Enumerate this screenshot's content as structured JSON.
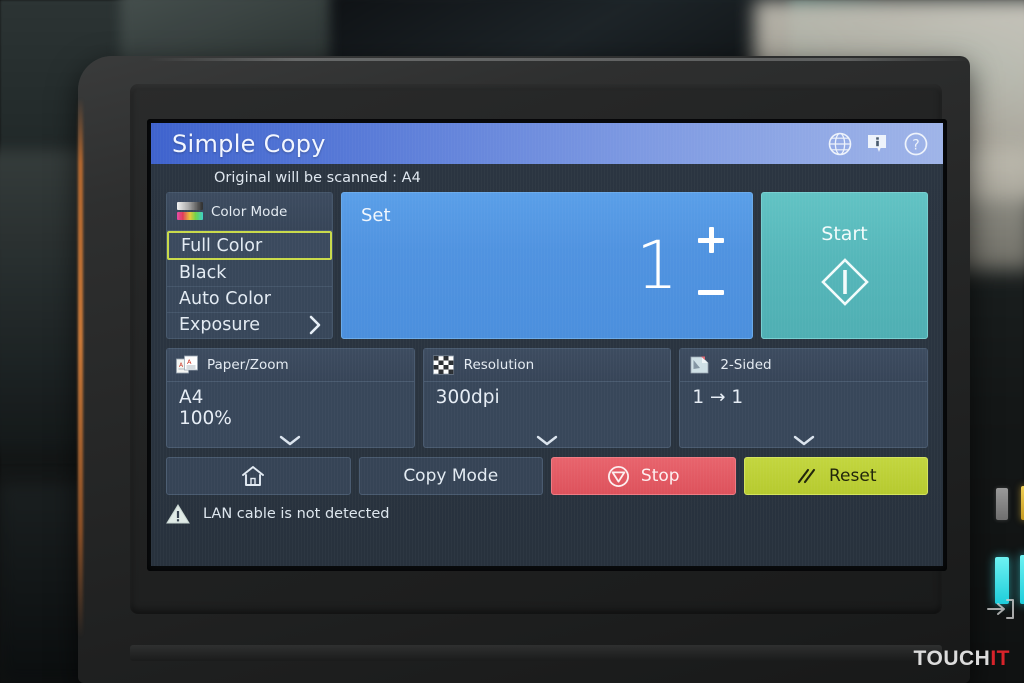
{
  "screen": {
    "title": "Simple Copy",
    "subtitle": "Original will be scanned : A4",
    "title_icons": [
      {
        "name": "globe-icon",
        "label": "Language"
      },
      {
        "name": "info-icon",
        "label": "Information"
      },
      {
        "name": "help-icon",
        "label": "Help"
      }
    ]
  },
  "color_mode": {
    "header": "Color Mode",
    "header_icon": "color-gradient-icon",
    "selected": "Full Color",
    "items": [
      {
        "label": "Full Color",
        "selected": true,
        "chevron": false
      },
      {
        "label": "Black",
        "selected": false,
        "chevron": false
      },
      {
        "label": "Auto Color",
        "selected": false,
        "chevron": false
      },
      {
        "label": "Exposure",
        "selected": false,
        "chevron": true
      }
    ]
  },
  "set_panel": {
    "label": "Set",
    "value": "1",
    "plus": "+",
    "minus": "−"
  },
  "start_button": {
    "label": "Start",
    "icon": "start-diamond-icon"
  },
  "tiles": [
    {
      "header": "Paper/Zoom",
      "icon": "paper-zoom-icon",
      "value_line1": "A4",
      "value_line2": "100%"
    },
    {
      "header": "Resolution",
      "icon": "resolution-checker-icon",
      "value_line1": "300dpi",
      "value_line2": ""
    },
    {
      "header": "2-Sided",
      "icon": "two-sided-icon",
      "value_line1": "1 → 1",
      "value_line2": ""
    }
  ],
  "actions": [
    {
      "name": "home",
      "label": "",
      "icon": "home-icon"
    },
    {
      "name": "copy-mode",
      "label": "Copy Mode",
      "icon": ""
    },
    {
      "name": "stop",
      "label": "Stop",
      "icon": "stop-icon"
    },
    {
      "name": "reset",
      "label": "Reset",
      "icon": "reset-icon"
    }
  ],
  "status": {
    "icon": "warning-triangle-icon",
    "message": "LAN cable is not detected"
  },
  "device": {
    "indicator_leds": [
      "gray",
      "amber",
      "cyan",
      "cyan"
    ],
    "panel_glyph": "arrow-into-slot-icon"
  },
  "watermark": {
    "part1": "TOUCH",
    "part2": "IT"
  },
  "colors": {
    "title_bar_start": "#3f63cd",
    "title_bar_end": "#9fb4e8",
    "screen_bg": "#2a3440",
    "tile_bg": "#38475a",
    "selection_outline": "#c9da4a",
    "set_panel": "#5093e0",
    "start_button": "#56b7ba",
    "stop_button": "#dd525c",
    "reset_button": "#b6ca2f",
    "watermark_accent": "#d8232a"
  }
}
